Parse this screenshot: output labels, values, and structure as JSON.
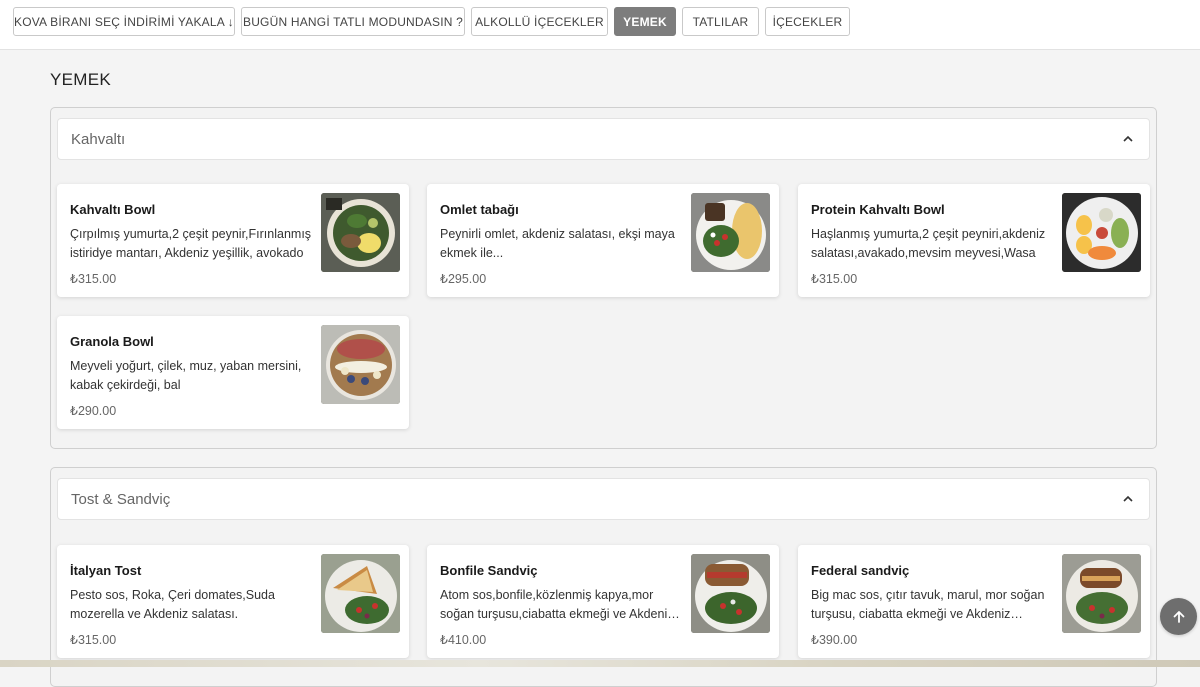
{
  "tabs": [
    {
      "label": "KOVA BİRANI SEÇ İNDİRİMİ YAKALA ↓",
      "active": false
    },
    {
      "label": "BUGÜN HANGİ TATLI MODUNDASIN ?",
      "active": false
    },
    {
      "label": "ALKOLLÜ İÇECEKLER",
      "active": false
    },
    {
      "label": "YEMEK",
      "active": true
    },
    {
      "label": "TATLILAR",
      "active": false
    },
    {
      "label": "İÇECEKLER",
      "active": false
    }
  ],
  "page_title": "YEMEK",
  "sections": [
    {
      "title": "Kahvaltı",
      "items": [
        {
          "name": "Kahvaltı Bowl",
          "description": "Çırpılmış yumurta,2 çeşit peynir,Fırınlanmış istiridye mantarı, Akdeniz yeşillik, avokado",
          "price": "₺315.00"
        },
        {
          "name": "Omlet tabağı",
          "description": "Peynirli omlet, akdeniz salatası, ekşi maya ekmek ile...",
          "price": "₺295.00"
        },
        {
          "name": "Protein Kahvaltı Bowl",
          "description": "Haşlanmış yumurta,2 çeşit peyniri,akdeniz salatası,avakado,mevsim meyvesi,Wasa",
          "price": "₺315.00"
        },
        {
          "name": "Granola Bowl",
          "description": "Meyveli yoğurt, çilek, muz, yaban mersini, kabak çekirdeği, bal",
          "price": "₺290.00"
        }
      ]
    },
    {
      "title": "Tost & Sandviç",
      "items": [
        {
          "name": "İtalyan Tost",
          "description": "Pesto sos, Roka, Çeri domates,Suda mozerella ve Akdeniz salatası.",
          "price": "₺315.00"
        },
        {
          "name": "Bonfile Sandviç",
          "description": "Atom sos,bonfile,közlenmiş kapya,mor soğan turşusu,ciabatta ekmeği ve Akdeniz salatası",
          "price": "₺410.00"
        },
        {
          "name": "Federal sandviç",
          "description": "Big mac sos, çıtır tavuk, marul, mor soğan turşusu, ciabatta ekmeği ve Akdeniz salatası",
          "price": "₺390.00"
        }
      ]
    }
  ],
  "icons": {
    "section_toggle": "chevron-up-icon",
    "scroll_top": "arrow-up-icon"
  },
  "colors": {
    "active_tab": "#7d7d7d",
    "scroll_button": "#6e6e6e"
  }
}
